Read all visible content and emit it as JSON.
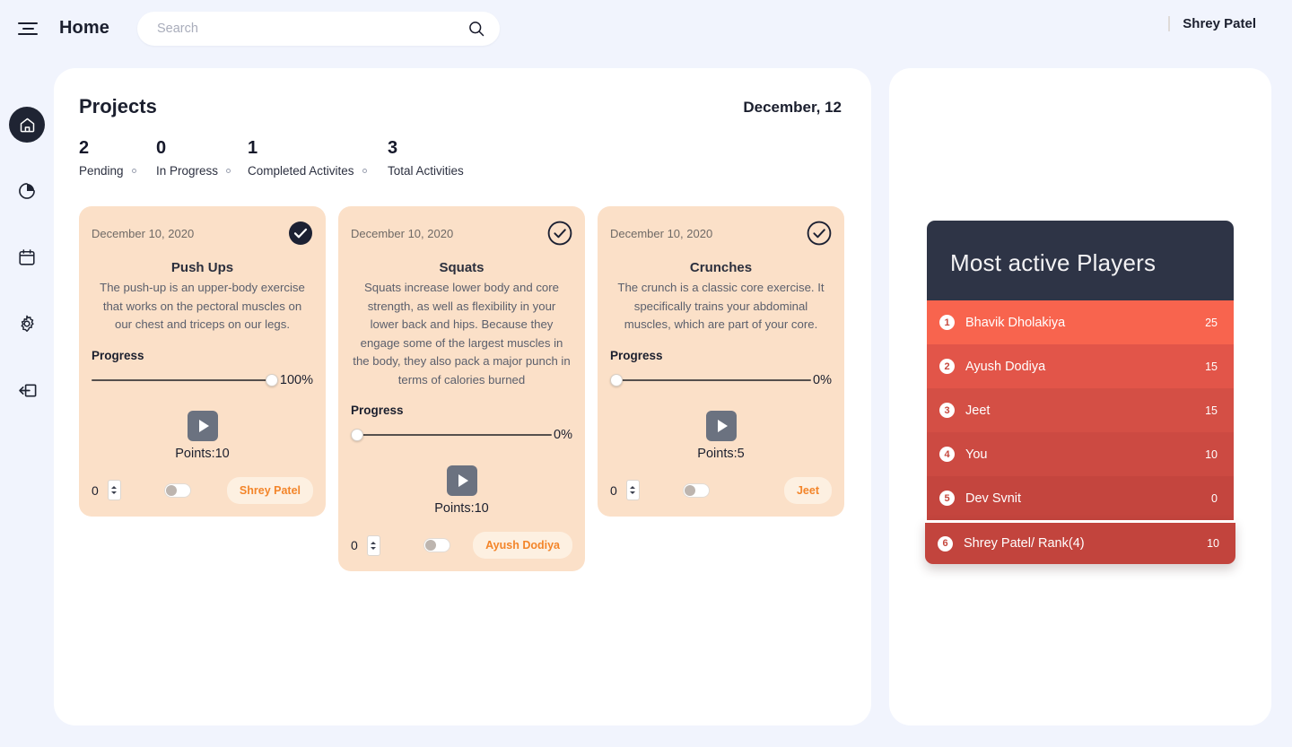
{
  "topbar": {
    "menu_icon": "hamburger-icon",
    "page_title": "Home",
    "search_placeholder": "Search",
    "search_value": "",
    "search_icon": "search-icon",
    "user_name": "Shrey Patel"
  },
  "sidebar": {
    "items": [
      {
        "icon": "home-icon",
        "name": "sidebar-item-home",
        "active": true
      },
      {
        "icon": "pie-chart-icon",
        "name": "sidebar-item-analytics",
        "active": false
      },
      {
        "icon": "calendar-icon",
        "name": "sidebar-item-calendar",
        "active": false
      },
      {
        "icon": "gear-icon",
        "name": "sidebar-item-settings",
        "active": false
      },
      {
        "icon": "logout-icon",
        "name": "sidebar-item-logout",
        "active": false
      }
    ]
  },
  "main": {
    "title": "Projects",
    "date": "December, 12",
    "stats": [
      {
        "num": "2",
        "label": "Pending"
      },
      {
        "num": "0",
        "label": "In Progress"
      },
      {
        "num": "1",
        "label": "Completed Activites"
      },
      {
        "num": "3",
        "label": "Total Activities"
      }
    ],
    "progress_label": "Progress",
    "cards": [
      {
        "date": "December 10, 2020",
        "title": "Push Ups",
        "desc": "The push-up is an upper-body exercise that works on the pectoral muscles on our chest and triceps on our legs.",
        "check_state": "filled",
        "progress_pct": 100,
        "progress_text": "100%",
        "points": "Points:10",
        "count": "0",
        "toggle_on": false,
        "owner": "Shrey Patel"
      },
      {
        "date": "December 10, 2020",
        "title": "Squats",
        "desc": "Squats increase lower body and core strength, as well as flexibility in your lower back and hips. Because they engage some of the largest muscles in the body, they also pack a major punch in terms of calories burned",
        "check_state": "outline",
        "progress_pct": 0,
        "progress_text": "0%",
        "points": "Points:10",
        "count": "0",
        "toggle_on": false,
        "owner": "Ayush Dodiya"
      },
      {
        "date": "December 10, 2020",
        "title": "Crunches",
        "desc": "The crunch is a classic core exercise. It specifically trains your abdominal muscles, which are part of your core.",
        "check_state": "outline",
        "progress_pct": 0,
        "progress_text": "0%",
        "points": "Points:5",
        "count": "0",
        "toggle_on": false,
        "owner": "Jeet"
      }
    ]
  },
  "leaderboard": {
    "title": "Most active Players",
    "header_color": "#2e3446",
    "rows": [
      {
        "rank": "1",
        "name": "Bhavik Dholakiya",
        "score": "25",
        "color": "#f8644e"
      },
      {
        "rank": "2",
        "name": "Ayush Dodiya",
        "score": "15",
        "color": "#e25549"
      },
      {
        "rank": "3",
        "name": "Jeet",
        "score": "15",
        "color": "#d44f45"
      },
      {
        "rank": "4",
        "name": "You",
        "score": "10",
        "color": "#cc4a42"
      },
      {
        "rank": "5",
        "name": "Dev Svnit",
        "score": "0",
        "color": "#c4453e"
      },
      {
        "rank": "6",
        "name": "Shrey Patel/ Rank(4)",
        "score": "10",
        "color": "#c2443d"
      }
    ]
  },
  "colors": {
    "page_bg": "#f1f4fd",
    "panel_bg": "#ffffff",
    "card_bg": "#fbe0c8",
    "accent_orange": "#f3852a",
    "dark": "#1f2433"
  }
}
